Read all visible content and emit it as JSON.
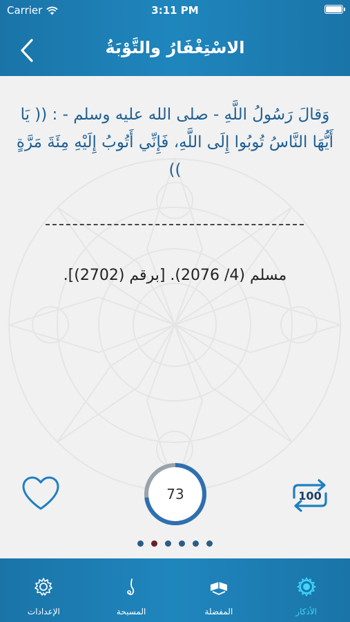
{
  "status_bar": {
    "carrier": "Carrier",
    "time": "3:11 PM"
  },
  "nav": {
    "title": "الاسْتِغْفَارُ والتَّوْبَةُ",
    "back_icon": "chevron-left-icon"
  },
  "zikr": {
    "text": "وَقالَ رَسُولُ اللَّهِ - صلى الله عليه وسلم - : (( يَا أَيُّهَا النَّاسُ تُوبُوا إِلَى اللَّهِ، فَإِنِّي أَتُوبُ إِلَيْهِ مِئَةَ مَرَّةٍ ))",
    "divider": "--------------------------------",
    "reference": "مسلم (4/ 2076). [برقم (2702)]."
  },
  "controls": {
    "favorite_icon": "heart-icon",
    "counter_value": "73",
    "counter_progress": 0.73,
    "repeat_icon": "repeat-icon",
    "repeat_total": "100"
  },
  "pager": {
    "count": 6,
    "active_index": 1
  },
  "tabs": [
    {
      "label": "الإعدادات",
      "icon": "gear-icon",
      "active": false
    },
    {
      "label": "المسبحة",
      "icon": "drop-icon",
      "active": false
    },
    {
      "label": "المفضلة",
      "icon": "quran-icon",
      "active": false
    },
    {
      "label": "الأذكار",
      "icon": "mandala-icon",
      "active": true
    }
  ],
  "colors": {
    "header": "#1f86bd",
    "text_blue": "#1e5f93",
    "counter_track": "#9aa3ab",
    "counter_progress": "#2f6fb0",
    "active_tab": "#3fd6ff"
  }
}
